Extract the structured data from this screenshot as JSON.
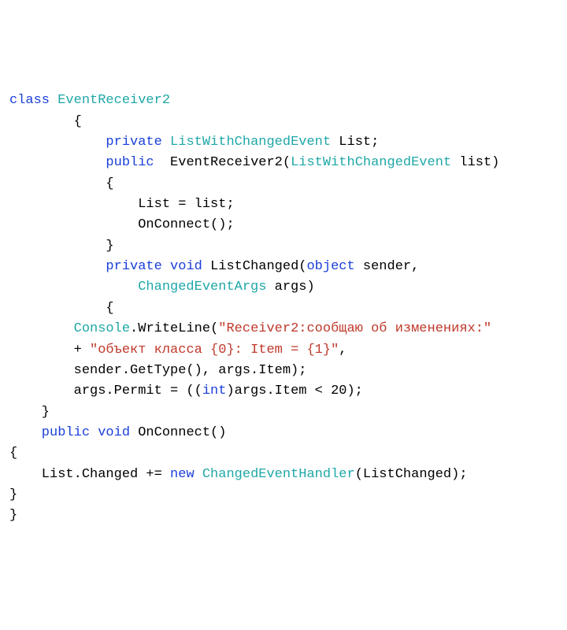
{
  "code": {
    "l1": {
      "kw_class": "class ",
      "type": "EventReceiver2"
    },
    "l2": {
      "t": "        {"
    },
    "l3": {
      "kw": "            private ",
      "type": "ListWithChangedEvent ",
      "rest": "List;"
    },
    "l4": {
      "kw": "            public  ",
      "name": "EventReceiver2(",
      "type": "ListWithChangedEvent ",
      "rest": "list)"
    },
    "l5": {
      "t": "            {"
    },
    "l6": {
      "t": "                List = list;"
    },
    "l7": {
      "t": "                OnConnect();"
    },
    "l8": {
      "t": "            }"
    },
    "l9": {
      "kw1": "            private ",
      "kw2": "void ",
      "name": "ListChanged(",
      "kw3": "object ",
      "rest": "sender,"
    },
    "l10": {
      "type": "                ChangedEventArgs ",
      "rest": "args)"
    },
    "l11": {
      "t": "            {"
    },
    "l12": {
      "pad": "        ",
      "type": "Console",
      "mid": ".WriteLine(",
      "str": "\"Receiver2:сообщаю об изменениях:\""
    },
    "l13": {
      "pad": "        + ",
      "str": "\"объект класса {0}: Item = {1}\"",
      "rest": ","
    },
    "l14": {
      "t": "        sender.GetType(), args.Item);"
    },
    "l15": {
      "a": "        args.Permit = ((",
      "kw": "int",
      "b": ")args.Item < 20);"
    },
    "l16": {
      "t": "    }"
    },
    "l17": {
      "kw1": "    public ",
      "kw2": "void ",
      "rest": "OnConnect()"
    },
    "l18": {
      "t": "{"
    },
    "l19": {
      "a": "    List.Changed += ",
      "kw": "new ",
      "type": "ChangedEventHandler",
      "b": "(ListChanged);"
    },
    "l20": {
      "t": "}"
    },
    "l21": {
      "t": "}"
    }
  }
}
